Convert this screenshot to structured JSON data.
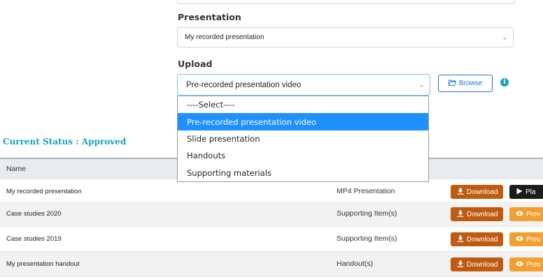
{
  "form": {
    "presentation_label": "Presentation",
    "presentation_value": "My recorded presentation",
    "upload_label": "Upload",
    "upload_value": "Pre-recorded presentation video",
    "browse_label": "Browse",
    "info_glyph": "i",
    "upload_options": [
      {
        "label": "----Select----",
        "selected": false
      },
      {
        "label": "Pre-recorded presentation video",
        "selected": true
      },
      {
        "label": "Slide presentation",
        "selected": false
      },
      {
        "label": "Handouts",
        "selected": false
      },
      {
        "label": "Supporting materials",
        "selected": false
      }
    ]
  },
  "status": {
    "text": "Current Status : Approved"
  },
  "table": {
    "header_name": "Name",
    "rows": [
      {
        "name": "My recorded presentation",
        "type": "MP4 Presentation",
        "download": "Download",
        "action": "Pla"
      },
      {
        "name": "Case studies 2020",
        "type": "Supporting Item(s)",
        "download": "Download",
        "action": "Prev"
      },
      {
        "name": "Case studies 2019",
        "type": "Supporting Item(s)",
        "download": "Download",
        "action": "Prev"
      },
      {
        "name": "My presentation handout",
        "type": "Handout(s)",
        "download": "Download",
        "action": "Prev"
      }
    ]
  },
  "colors": {
    "accent": "#17a2b8",
    "download_button": "#c05a10",
    "preview_button": "#f0a030",
    "play_button": "#1c1c1c",
    "selected_option": "#1e90ff",
    "browse": "#1976d2"
  },
  "icons": {
    "chevron": "chevron-down-icon",
    "browse": "folder-open-icon",
    "info": "info-icon",
    "download": "download-icon",
    "play": "play-icon",
    "preview": "eye-icon"
  }
}
